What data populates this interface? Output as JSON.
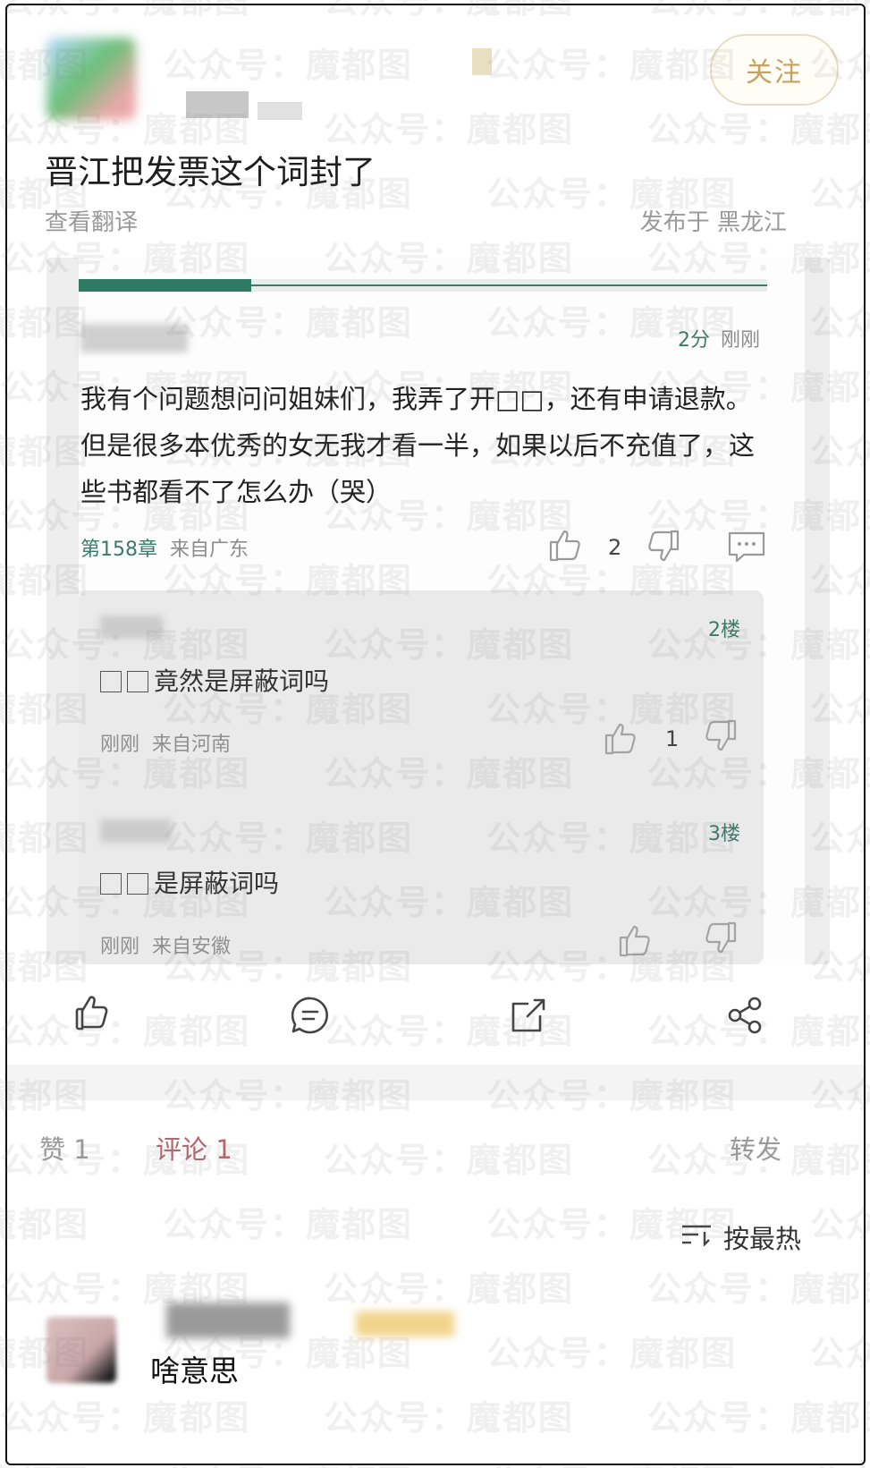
{
  "header": {
    "follow_label": "关注"
  },
  "post": {
    "title": "晋江把发票这个词封了",
    "translate_label": "查看翻译",
    "location": "发布于 黑龙江"
  },
  "screenshot_card": {
    "progress": 0.25,
    "comment": {
      "score": "2分",
      "time": "刚刚",
      "text": "我有个问题想问问姐妹们，我弄了开□□，还有申请退款。但是很多本优秀的女无我才看一半，如果以后不充值了，这些书都看不了怎么办（哭）",
      "chapter": "第158章",
      "from": "来自广东",
      "like_count": "2"
    },
    "replies": [
      {
        "floor": "2楼",
        "text": "竟然是屏蔽词吗",
        "time": "刚刚",
        "from": "来自河南",
        "like_count": "1"
      },
      {
        "floor": "3楼",
        "text": "是屏蔽词吗",
        "time": "刚刚",
        "from": "来自安徽",
        "like_count": ""
      }
    ]
  },
  "actions": [
    "thumb-up-icon",
    "comment-icon",
    "share-out-icon",
    "share-icon"
  ],
  "stats": {
    "likes": "赞 1",
    "comments": "评论 1",
    "forward": "转发"
  },
  "sort_label": "按最热",
  "reply": {
    "text": "啥意思"
  },
  "watermark": {
    "text": "公众号：魔都图",
    "color": "#787878"
  }
}
